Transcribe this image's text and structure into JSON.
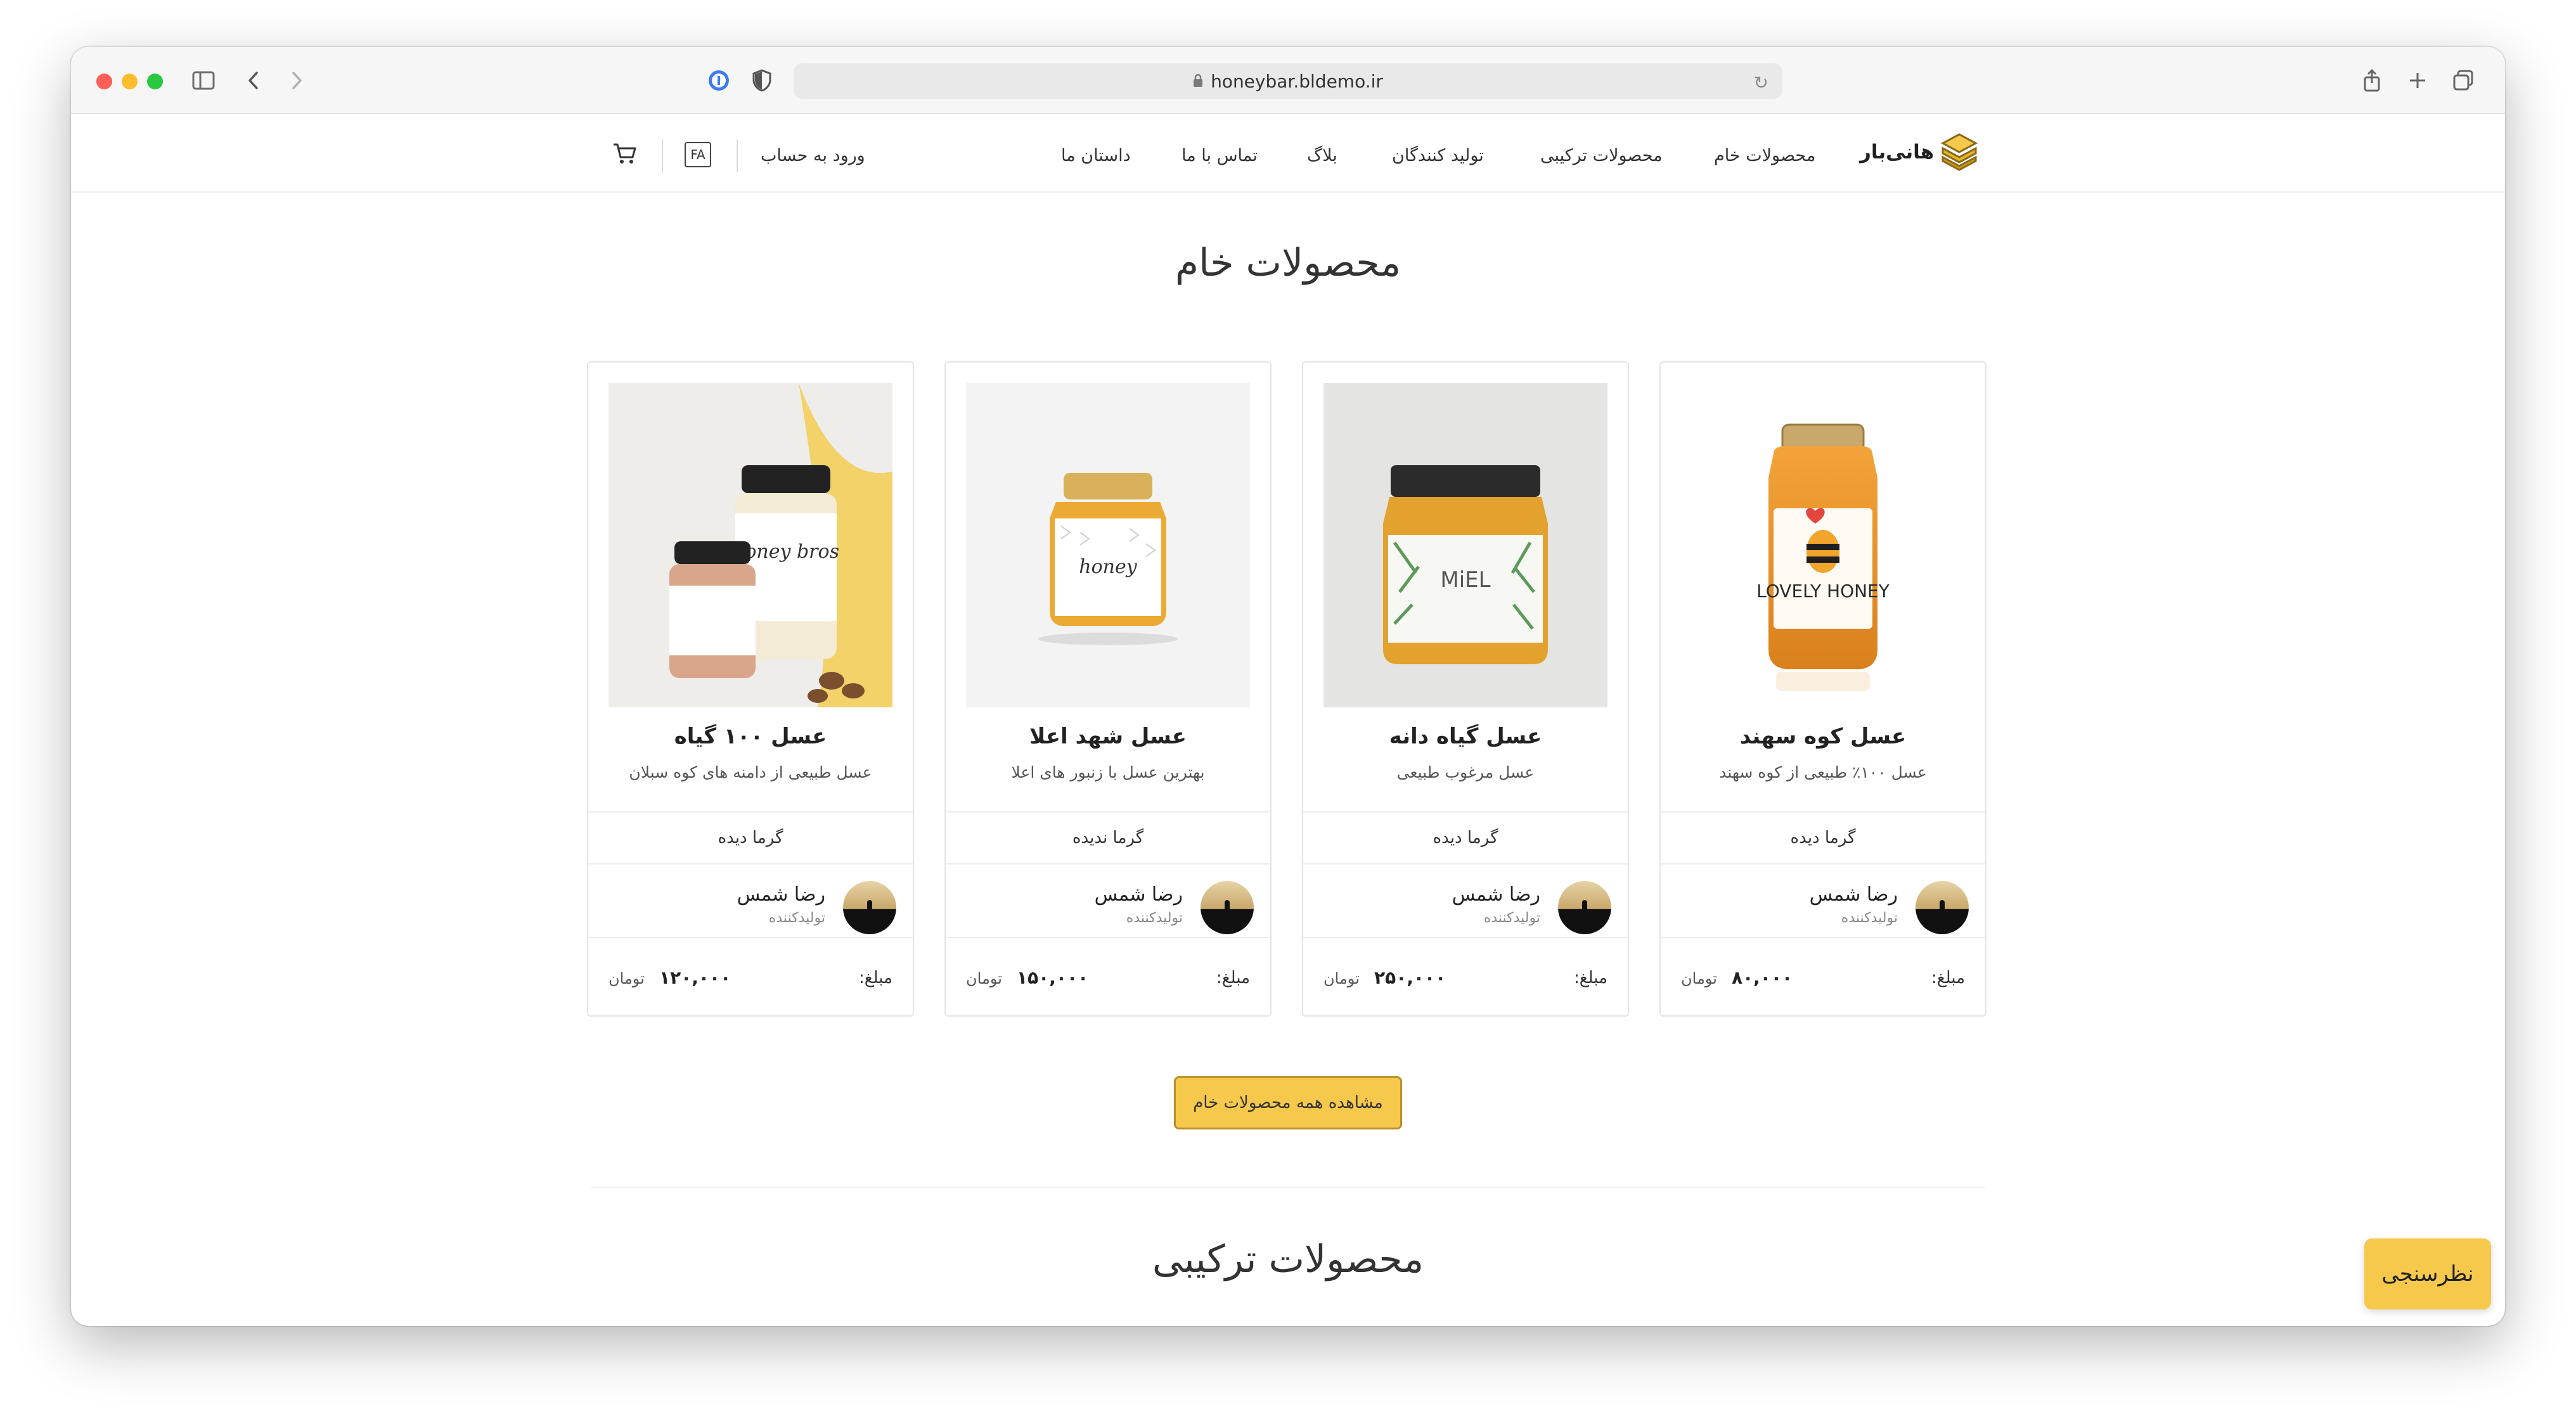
{
  "browser": {
    "url": "honeybar.bldemo.ir"
  },
  "header": {
    "logo_text": "هانی‌بار",
    "nav": [
      "محصولات خام",
      "محصولات ترکیبی",
      "تولید کنندگان",
      "بلاگ",
      "تماس با ما",
      "داستان ما"
    ],
    "login": "ورود به حساب",
    "lang": "FA"
  },
  "section1": {
    "title": "محصولات خام",
    "cta": "مشاهده همه محصولات خام"
  },
  "section2": {
    "title": "محصولات ترکیبی"
  },
  "products": [
    {
      "title": "عسل کوه سهند",
      "desc": "عسل ۱۰۰٪ طبیعی از کوه سهند",
      "heat": "گرما دیده",
      "producer": "رضا شمس",
      "role": "تولیدکننده",
      "price_label": "مبلغ:",
      "price": "۸۰,۰۰۰",
      "currency": "تومان",
      "jar_label": "LOVELY HONEY"
    },
    {
      "title": "عسل گیاه دانه",
      "desc": "عسل مرغوب طبیعی",
      "heat": "گرما دیده",
      "producer": "رضا شمس",
      "role": "تولیدکننده",
      "price_label": "مبلغ:",
      "price": "۲۵۰,۰۰۰",
      "currency": "تومان",
      "jar_label": "MiEL"
    },
    {
      "title": "عسل شهد اعلا",
      "desc": "بهترین عسل با زنبور های اعلا",
      "heat": "گرما ندیده",
      "producer": "رضا شمس",
      "role": "تولیدکننده",
      "price_label": "مبلغ:",
      "price": "۱۵۰,۰۰۰",
      "currency": "تومان",
      "jar_label": "honey"
    },
    {
      "title": "عسل ۱۰۰ گیاه",
      "desc": "عسل طبیعی از دامنه های کوه سبلان",
      "heat": "گرما دیده",
      "producer": "رضا شمس",
      "role": "تولیدکننده",
      "price_label": "مبلغ:",
      "price": "۱۲۰,۰۰۰",
      "currency": "تومان",
      "jar_label": "honey bros"
    }
  ],
  "survey": "نظرسنجی",
  "colors": {
    "accent": "#f6c94d",
    "accent_border": "#b9912b"
  }
}
